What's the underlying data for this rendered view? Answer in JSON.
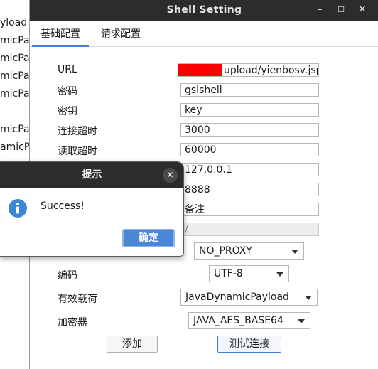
{
  "background_list": {
    "items": [
      "yload",
      "micPa",
      "micPa",
      "micPa",
      "micPa",
      "micPa",
      "amicP"
    ]
  },
  "window": {
    "title": "Shell Setting",
    "controls": {
      "minimize": "–",
      "maximize": "☐",
      "close": "✕"
    },
    "tabs": [
      {
        "label": "基础配置",
        "active": true
      },
      {
        "label": "请求配置",
        "active": false
      }
    ],
    "form": {
      "url_label": "URL",
      "url_value": "upload/yienbosv.jsp",
      "password_label": "密码",
      "password_value": "gslshell",
      "key_label": "密钥",
      "key_value": "key",
      "connect_timeout_label": "连接超时",
      "connect_timeout_value": "3000",
      "read_timeout_label": "读取超时",
      "read_timeout_value": "60000",
      "host_value": "127.0.0.1",
      "port_value": "8888",
      "remark_value": "备注",
      "disabled_value": "/",
      "proxy_value": "NO_PROXY",
      "encoding_label": "编码",
      "encoding_value": "UTF-8",
      "payload_label": "有效载荷",
      "payload_value": "JavaDynamicPayload",
      "crypto_label": "加密器",
      "crypto_value": "JAVA_AES_BASE64"
    },
    "buttons": {
      "add": "添加",
      "test": "测试连接"
    }
  },
  "dialog": {
    "title": "提示",
    "close": "✕",
    "message": "Success!",
    "ok_label": "确定",
    "icon": "info-icon"
  },
  "colors": {
    "titlebar": "#2c2c2c",
    "accent": "#3d7fd4",
    "ok_button": "#4a86d6",
    "info_icon": "#3c86d4",
    "redaction": "#ff0000"
  }
}
